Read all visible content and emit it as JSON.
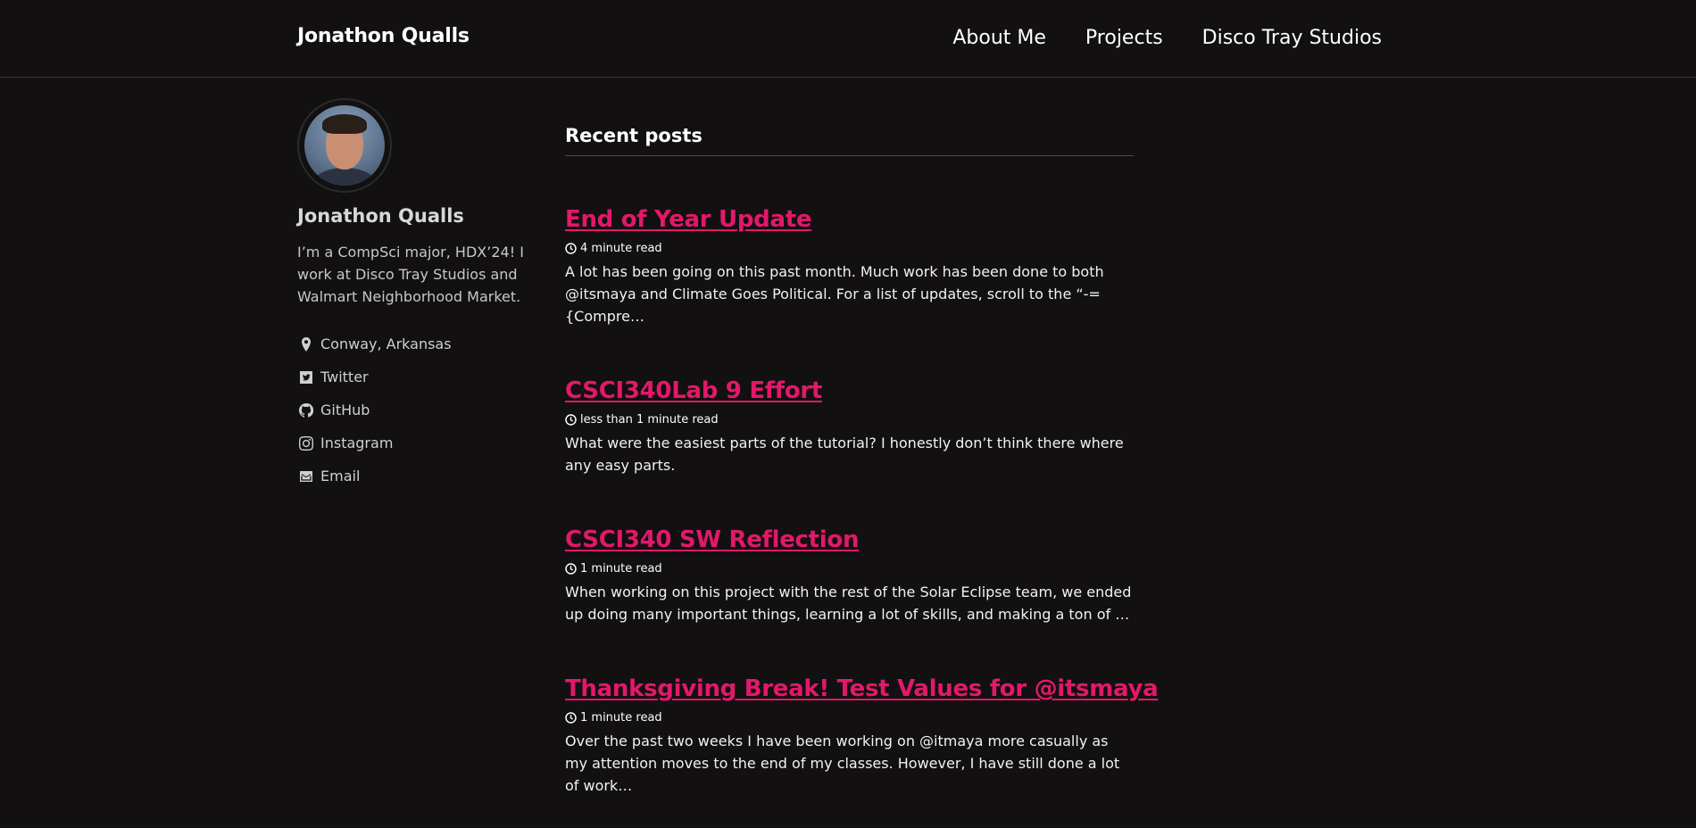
{
  "masthead": {
    "site_title": "Jonathon Qualls",
    "nav": [
      "About Me",
      "Projects",
      "Disco Tray Studios"
    ]
  },
  "sidebar": {
    "name": "Jonathon Qualls",
    "bio": "I’m a CompSci major, HDX’24! I work at Disco Tray Studios and Walmart Neighborhood Market.",
    "links": [
      {
        "label": "Conway, Arkansas",
        "icon": "map-marker-icon"
      },
      {
        "label": "Twitter",
        "icon": "twitter-icon"
      },
      {
        "label": "GitHub",
        "icon": "github-icon"
      },
      {
        "label": "Instagram",
        "icon": "instagram-icon"
      },
      {
        "label": "Email",
        "icon": "email-icon"
      }
    ]
  },
  "main": {
    "heading": "Recent posts",
    "posts": [
      {
        "title": "End of Year Update",
        "read_time": "4 minute read",
        "excerpt": "A lot has been going on this past month. Much work has been done to both @itsmaya and Climate Goes Political. For a list of updates, scroll to the “-={Compre…"
      },
      {
        "title": "CSCI340Lab 9 Effort",
        "read_time": "less than 1 minute read",
        "excerpt": "What were the easiest parts of the tutorial? I honestly don’t think there where any easy parts."
      },
      {
        "title": "CSCI340 SW Reflection",
        "read_time": "1 minute read",
        "excerpt": "When working on this project with the rest of the Solar Eclipse team, we ended up doing many important things, learning a lot of skills, and making a ton of …"
      },
      {
        "title": "Thanksgiving Break! Test Values for @itsmaya",
        "read_time": "1 minute read",
        "excerpt": "Over the past two weeks I have been working on @itmaya more casually as my attention moves to the end of my classes. However, I have still done a lot of work…"
      }
    ]
  },
  "colors": {
    "background": "#121010",
    "accent": "#e3186a",
    "text": "#ffffff"
  }
}
